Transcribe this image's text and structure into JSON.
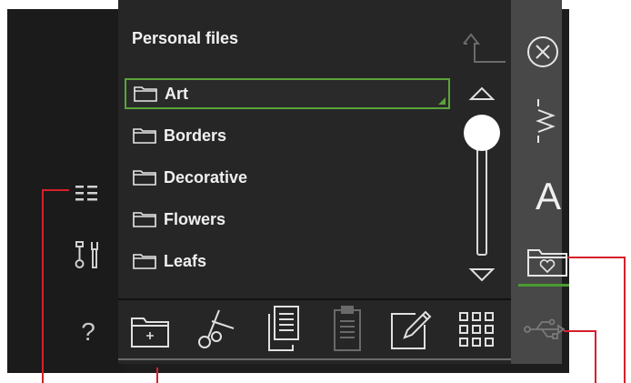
{
  "panel": {
    "title": "Personal files"
  },
  "files": [
    {
      "label": "Art",
      "selected": true
    },
    {
      "label": "Borders",
      "selected": false
    },
    {
      "label": "Decorative",
      "selected": false
    },
    {
      "label": "Flowers",
      "selected": false
    },
    {
      "label": "Leafs",
      "selected": false
    }
  ],
  "left_strip": {
    "list_view_icon": "list-view-icon",
    "tools_icon": "tools-icon",
    "help_label": "?"
  },
  "right_bar": {
    "close_icon": "close-icon",
    "stitch_icon": "stitch-icon",
    "font_label": "A",
    "personal_folder_icon": "personal-folder-icon",
    "usb_icon": "usb-icon"
  },
  "toolbar": [
    "new-folder-icon",
    "cut-icon",
    "copy-icon",
    "paste-icon",
    "rename-icon",
    "grid-view-icon"
  ],
  "colors": {
    "accent_green": "#5aa43a",
    "callout_red": "#d6202a",
    "screen_bg": "#1d1d1d"
  }
}
